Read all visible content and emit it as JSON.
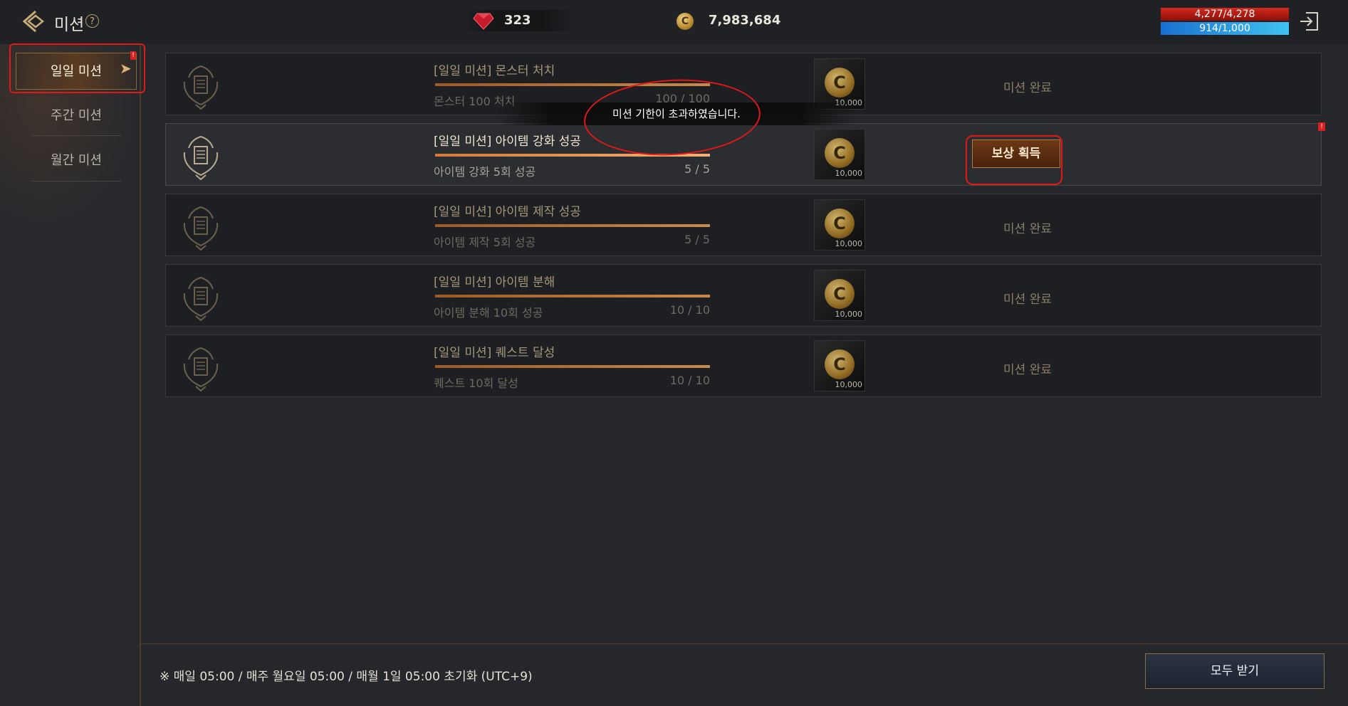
{
  "header": {
    "title": "미션",
    "help_glyph": "?",
    "gems": "323",
    "coin_glyph": "C",
    "coins": "7,983,684",
    "hp": "4,277/4,278",
    "mp": "914/1,000",
    "icons": [
      "back-icon",
      "help-icon",
      "gem-icon",
      "coin-icon",
      "exit-icon"
    ]
  },
  "sidebar": {
    "tabs": [
      {
        "label": "일일 미션",
        "active": true,
        "badge": "!"
      },
      {
        "label": "주간 미션",
        "active": false
      },
      {
        "label": "월간 미션",
        "active": false
      }
    ]
  },
  "missions": [
    {
      "title": "[일일 미션] 몬스터 처치",
      "desc": "몬스터 100 처치",
      "count": "100 / 100",
      "progress": 1.0,
      "reward_qty": "10,000",
      "status": "미션 완료"
    },
    {
      "title": "[일일 미션] 아이템 강화 성공",
      "desc": "아이템 강화 5회 성공",
      "count": "5 / 5",
      "progress": 1.0,
      "reward_qty": "10,000",
      "status": "보상 획득",
      "badge": "!"
    },
    {
      "title": "[일일 미션] 아이템 제작 성공",
      "desc": "아이템 제작 5회 성공",
      "count": "5 / 5",
      "progress": 1.0,
      "reward_qty": "10,000",
      "status": "미션 완료"
    },
    {
      "title": "[일일 미션] 아이템 분해",
      "desc": "아이템 분해 10회 성공",
      "count": "10 / 10",
      "progress": 1.0,
      "reward_qty": "10,000",
      "status": "미션 완료"
    },
    {
      "title": "[일일 미션] 퀘스트 달성",
      "desc": "퀘스트 10회 달성",
      "count": "10 / 10",
      "progress": 1.0,
      "reward_qty": "10,000",
      "status": "미션 완료"
    }
  ],
  "toast": "미션 기한이 초과하였습니다.",
  "footer": {
    "note": "※ 매일 05:00 / 매주 월요일 05:00 / 매월 1일 05:00 초기화 (UTC+9)",
    "claim_all": "모두 받기"
  },
  "colors": {
    "background": "#25272b",
    "accent": "#c98a4a",
    "hp": "#d42a1e",
    "mp": "#3ec3f2",
    "annotation": "#e01818"
  }
}
